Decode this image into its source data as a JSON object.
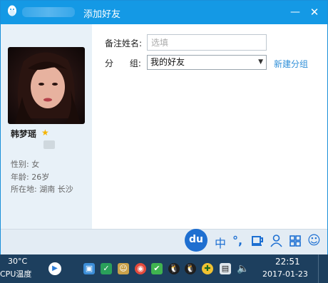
{
  "window": {
    "title": "添加好友",
    "minimize": "—",
    "close": "✕"
  },
  "profile": {
    "name": "韩梦瑶",
    "gender_label": "性别:",
    "gender_value": "女",
    "age_label": "年龄:",
    "age_value": "26岁",
    "location_label": "所在地:",
    "location_value": "湖南  长沙"
  },
  "form": {
    "nickname_label": "备注姓名:",
    "nickname_placeholder": "选填",
    "group_label": "分      组:",
    "group_value": "我的好友",
    "new_group": "新建分组"
  },
  "ime": {
    "logo": "du",
    "lang": "中",
    "punct": "°,",
    "smile": "☺"
  },
  "taskbar": {
    "temperature": "30°C",
    "cpu_label": "CPU温度",
    "time": "22:51",
    "date": "2017-01-23"
  },
  "colors": {
    "title_bar": "#1499e5",
    "taskbar": "#1d3f5e",
    "link": "#2f8fd8"
  }
}
